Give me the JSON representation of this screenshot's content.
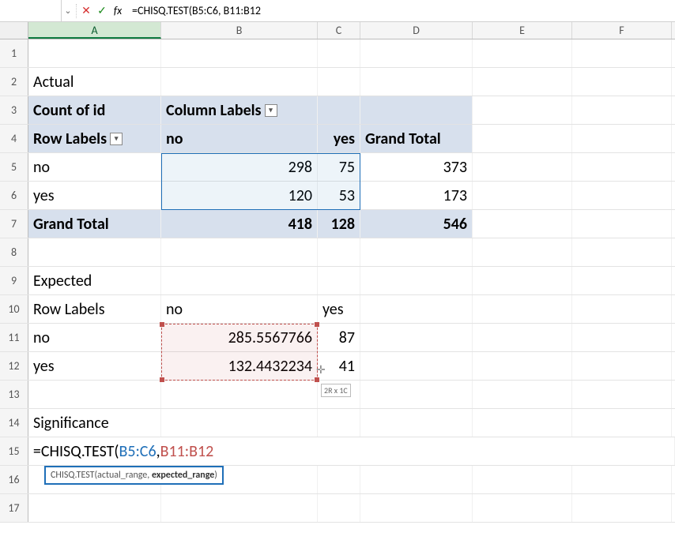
{
  "formula_bar": {
    "cancel": "✕",
    "confirm": "✓",
    "fx": "fx",
    "formula": "=CHISQ.TEST(B5:C6, B11:B12"
  },
  "columns": [
    "A",
    "B",
    "C",
    "D",
    "E",
    "F"
  ],
  "rows": {
    "r2": {
      "A": "Actual"
    },
    "r3": {
      "A": "Count of id",
      "B": "Column Labels"
    },
    "r4": {
      "A": "Row Labels",
      "B": "no",
      "C": "yes",
      "D": "Grand Total"
    },
    "r5": {
      "A": "no",
      "B": "298",
      "C": "75",
      "D": "373"
    },
    "r6": {
      "A": "yes",
      "B": "120",
      "C": "53",
      "D": "173"
    },
    "r7": {
      "A": "Grand Total",
      "B": "418",
      "C": "128",
      "D": "546"
    },
    "r9": {
      "A": "Expected"
    },
    "r10": {
      "A": "Row Labels",
      "B": "no",
      "C": "yes"
    },
    "r11": {
      "A": "no",
      "B": "285.5567766",
      "C": "87"
    },
    "r12": {
      "A": "yes",
      "B": "132.4432234",
      "C": "41"
    },
    "r14": {
      "A": "Significance"
    }
  },
  "formula_cell": {
    "prefix": "=CHISQ.TEST(",
    "arg1": "B5:C6",
    "sep": ", ",
    "arg2": "B11:B12"
  },
  "tooltip": {
    "func": "CHISQ.TEST(",
    "arg1": "actual_range, ",
    "arg2": "expected_range",
    "close": ")"
  },
  "size_hint": "2R x 1C",
  "chart_data": {
    "type": "table",
    "actual": {
      "rows": [
        "no",
        "yes"
      ],
      "cols": [
        "no",
        "yes"
      ],
      "values": [
        [
          298,
          75
        ],
        [
          120,
          53
        ]
      ],
      "row_totals": [
        373,
        173
      ],
      "col_totals": [
        418,
        128
      ],
      "grand_total": 546
    },
    "expected": {
      "rows": [
        "no",
        "yes"
      ],
      "cols": [
        "no",
        "yes"
      ],
      "values": [
        [
          285.5567766,
          87
        ],
        [
          132.4432234,
          41
        ]
      ]
    }
  }
}
